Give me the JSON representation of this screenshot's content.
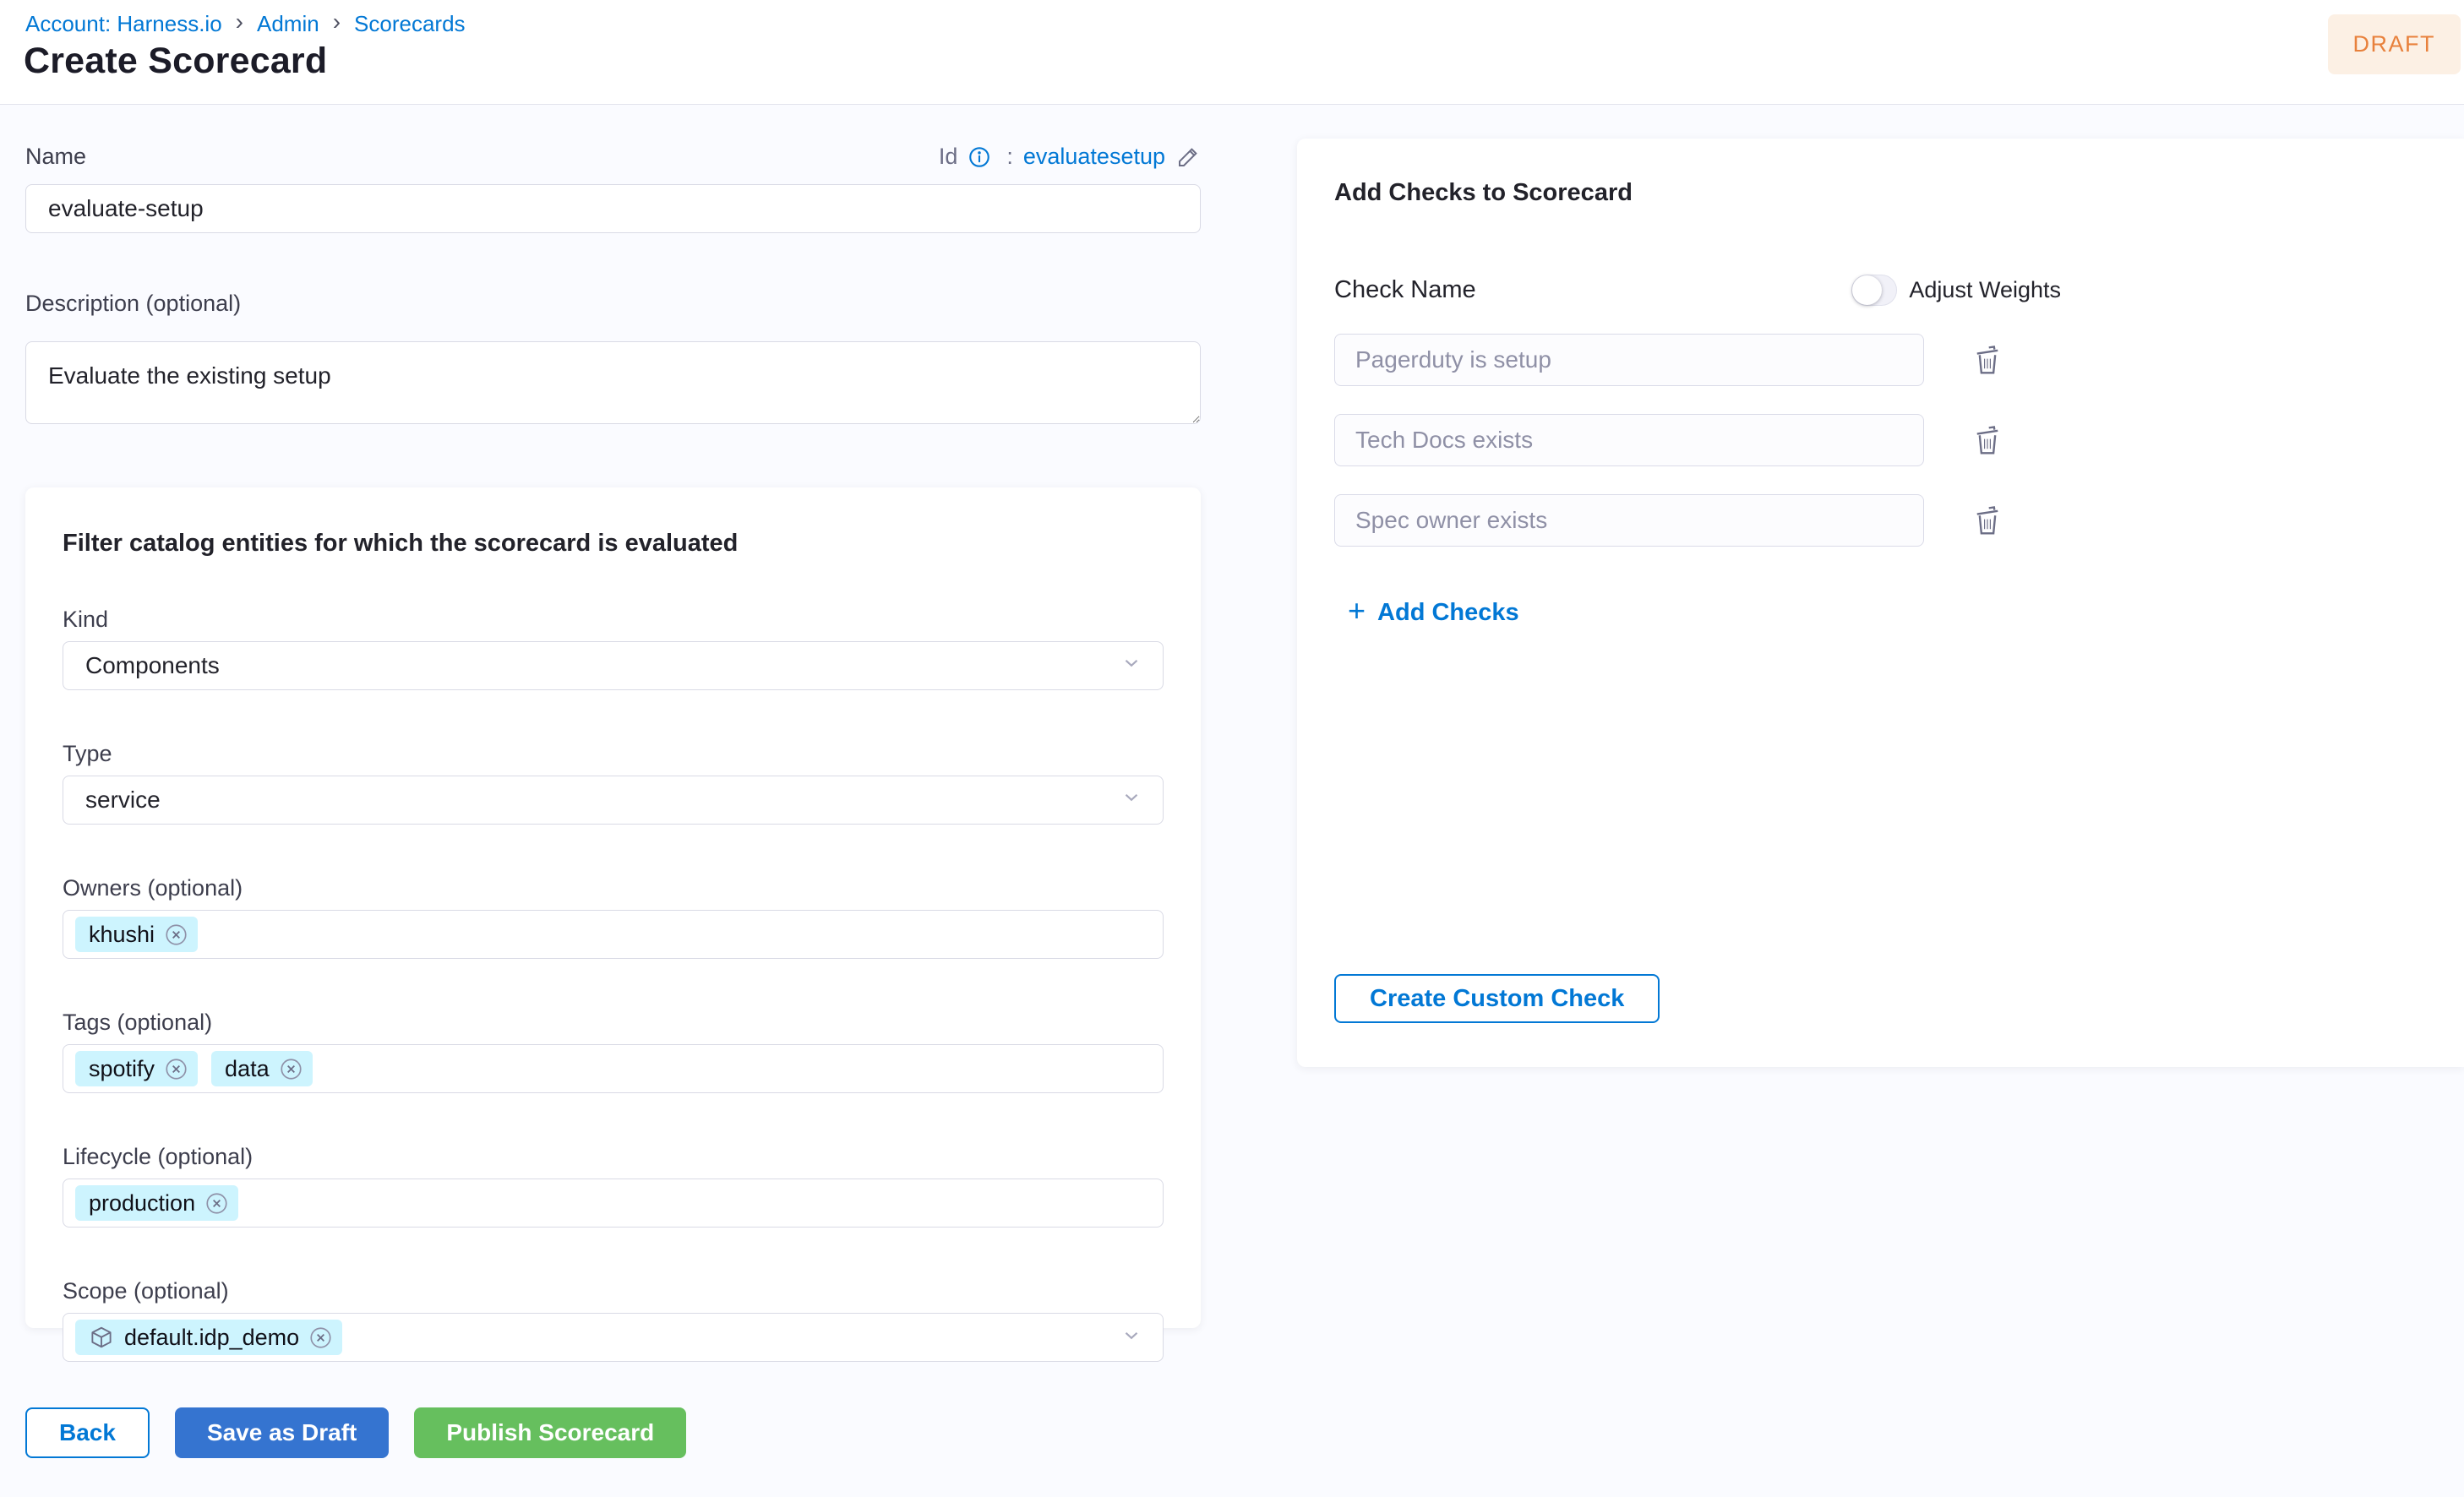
{
  "header": {
    "breadcrumb": {
      "items": [
        "Account: Harness.io",
        "Admin",
        "Scorecards"
      ],
      "separator": "›"
    },
    "title": "Create Scorecard",
    "status_badge": "DRAFT"
  },
  "form": {
    "name_label": "Name",
    "name_value": "evaluate-setup",
    "id_label": "Id",
    "id_separator": ":",
    "id_value": "evaluatesetup",
    "description_label": "Description (optional)",
    "description_value": "Evaluate the existing setup",
    "filter": {
      "title": "Filter catalog entities for which the scorecard is evaluated",
      "kind_label": "Kind",
      "kind_value": "Components",
      "type_label": "Type",
      "type_value": "service",
      "owners_label": "Owners (optional)",
      "owners_chips": [
        "khushi"
      ],
      "tags_label": "Tags (optional)",
      "tags_chips": [
        "spotify",
        "data"
      ],
      "lifecycle_label": "Lifecycle (optional)",
      "lifecycle_chips": [
        "production"
      ],
      "scope_label": "Scope (optional)",
      "scope_chips": [
        "default.idp_demo"
      ]
    },
    "actions": {
      "back": "Back",
      "save_as_draft": "Save as Draft",
      "publish": "Publish Scorecard"
    }
  },
  "checks_panel": {
    "title": "Add Checks to Scorecard",
    "check_name_label": "Check Name",
    "adjust_weights_label": "Adjust Weights",
    "checks": [
      "Pagerduty is setup",
      "Tech Docs exists",
      "Spec owner exists"
    ],
    "add_checks_plus": "+",
    "add_checks_label": "Add Checks",
    "create_custom_check_label": "Create Custom Check"
  },
  "colors": {
    "accent_blue": "#0278d5",
    "save_button_blue": "#3574d0",
    "publish_button_green": "#66bf5e",
    "draft_badge_text": "#e8813c",
    "draft_badge_bg": "#fcf0e4",
    "chip_bg": "#cdf4fe",
    "page_bg": "#fafbff"
  }
}
